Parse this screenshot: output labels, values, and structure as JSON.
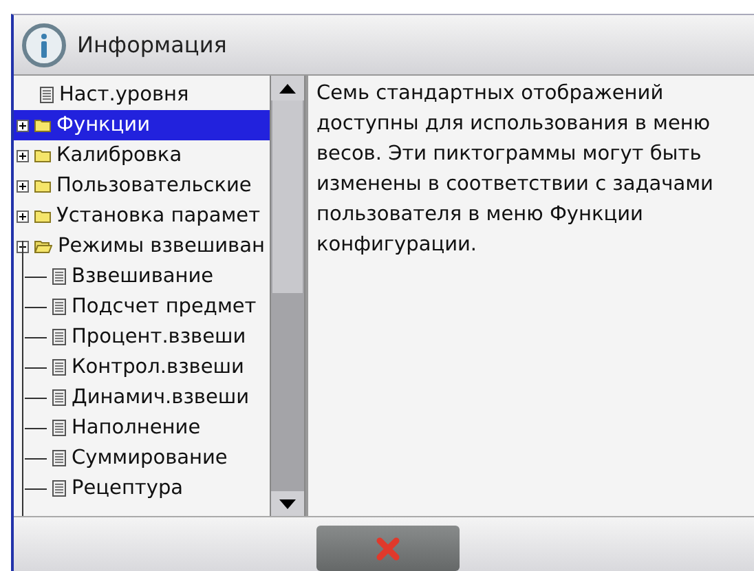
{
  "window": {
    "title": "Информация"
  },
  "tree": [
    {
      "label": "Наст.уровня",
      "kind": "page",
      "selected": false
    },
    {
      "label": "Функции",
      "kind": "folder",
      "expanded": false,
      "selected": true
    },
    {
      "label": "Калибровка",
      "kind": "folder",
      "expanded": false,
      "selected": false
    },
    {
      "label": "Пользовательские",
      "kind": "folder",
      "expanded": false,
      "selected": false
    },
    {
      "label": "Установка парамет",
      "kind": "folder",
      "expanded": false,
      "selected": false
    },
    {
      "label": "Режимы взвешиван",
      "kind": "folder",
      "expanded": true,
      "selected": false,
      "children": [
        {
          "label": "Взвешивание",
          "kind": "page",
          "selected": false
        },
        {
          "label": "Подсчет предмет",
          "kind": "page",
          "selected": false
        },
        {
          "label": "Процент.взвеши",
          "kind": "page",
          "selected": false
        },
        {
          "label": "Контрол.взвеши",
          "kind": "page",
          "selected": false
        },
        {
          "label": "Динамич.взвеши",
          "kind": "page",
          "selected": false
        },
        {
          "label": "Наполнение",
          "kind": "page",
          "selected": false
        },
        {
          "label": "Суммирование",
          "kind": "page",
          "selected": false
        },
        {
          "label": "Рецептура",
          "kind": "page",
          "selected": false
        }
      ]
    }
  ],
  "description": "Семь стандартных отображений доступны для использования в меню весов. Эти пиктограммы могут быть изменены в соответствии с задачами пользователя в меню Функции конфигурации."
}
